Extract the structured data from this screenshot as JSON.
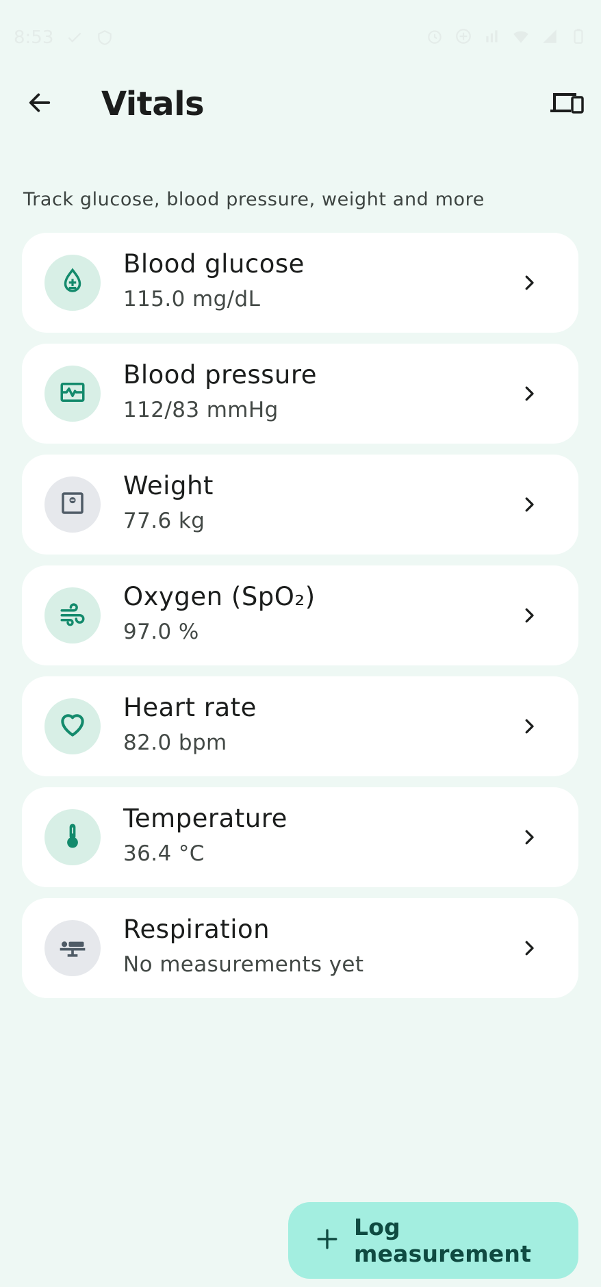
{
  "status_bar": {
    "time": "8:53"
  },
  "app_bar": {
    "title": "Vitals"
  },
  "subtitle": "Track glucose, blood pressure, weight and more",
  "vitals": [
    {
      "label": "Blood glucose",
      "value": "115.0 mg/dL",
      "icon": "blood-drop-icon"
    },
    {
      "label": "Blood pressure",
      "value": "112/83 mmHg",
      "icon": "monitor-heart-icon"
    },
    {
      "label": "Weight",
      "value": "77.6 kg",
      "icon": "scale-icon"
    },
    {
      "label": "Oxygen (SpO₂)",
      "value": "97.0 %",
      "icon": "air-icon"
    },
    {
      "label": "Heart rate",
      "value": "82.0 bpm",
      "icon": "heart-icon"
    },
    {
      "label": "Temperature",
      "value": "36.4 °C",
      "icon": "thermometer-icon"
    },
    {
      "label": "Respiration",
      "value": "No measurements yet",
      "icon": "respiration-icon"
    }
  ],
  "fab": {
    "label": "Log measurement"
  },
  "colors": {
    "background": "#eef8f4",
    "accent": "#138a6c",
    "icon_bg_green": "#d8efe6",
    "icon_bg_grey": "#e6e8ec",
    "fab_bg": "#a3eee0"
  }
}
